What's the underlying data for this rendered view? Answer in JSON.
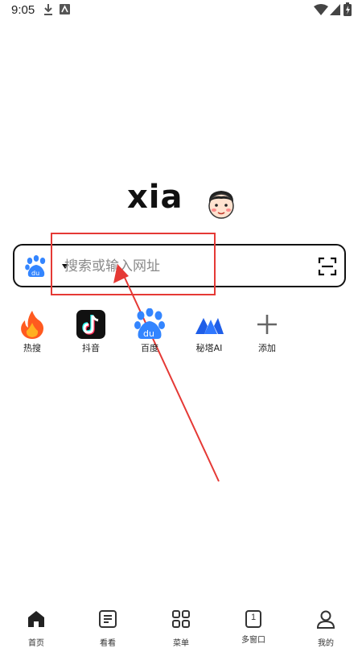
{
  "status_bar": {
    "time": "9:05"
  },
  "logo": {
    "text": "xia"
  },
  "search": {
    "placeholder": "搜索或输入网址"
  },
  "shortcuts": [
    {
      "label": "热搜",
      "icon": "fire-icon"
    },
    {
      "label": "抖音",
      "icon": "douyin-icon"
    },
    {
      "label": "百度",
      "icon": "baidu-icon"
    },
    {
      "label": "秘塔AI",
      "icon": "metaso-icon"
    },
    {
      "label": "添加",
      "icon": "plus-icon"
    }
  ],
  "bottom_nav": [
    {
      "label": "首页",
      "icon": "home-icon"
    },
    {
      "label": "看看",
      "icon": "document-icon"
    },
    {
      "label": "菜单",
      "icon": "grid-icon"
    },
    {
      "label": "多窗口",
      "icon": "window-icon",
      "badge": "1"
    },
    {
      "label": "我的",
      "icon": "user-icon"
    }
  ],
  "colors": {
    "annotation": "#e53935",
    "baidu_blue": "#3385ff",
    "fire": "#ff5a1f"
  }
}
